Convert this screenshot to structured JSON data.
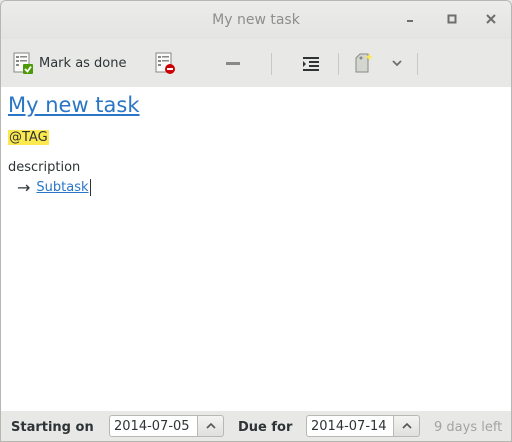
{
  "window": {
    "title": "My new task"
  },
  "toolbar": {
    "mark_done_label": "Mark as done",
    "icons": [
      "task-done-icon",
      "dismiss-icon",
      "delete-icon",
      "indent-icon",
      "add-tag-icon",
      "chevron-down-icon"
    ]
  },
  "task": {
    "title": "My new task",
    "tag": "@TAG",
    "description": "description",
    "subtask_arrow": "→",
    "subtask": "Subtask"
  },
  "footer": {
    "start_label": "Starting on",
    "start_date": "2014-07-05",
    "due_label": "Due for",
    "due_date": "2014-07-14",
    "days_left": "9 days left"
  },
  "colors": {
    "link": "#2a76c6",
    "tag_highlight": "#fce94f"
  }
}
